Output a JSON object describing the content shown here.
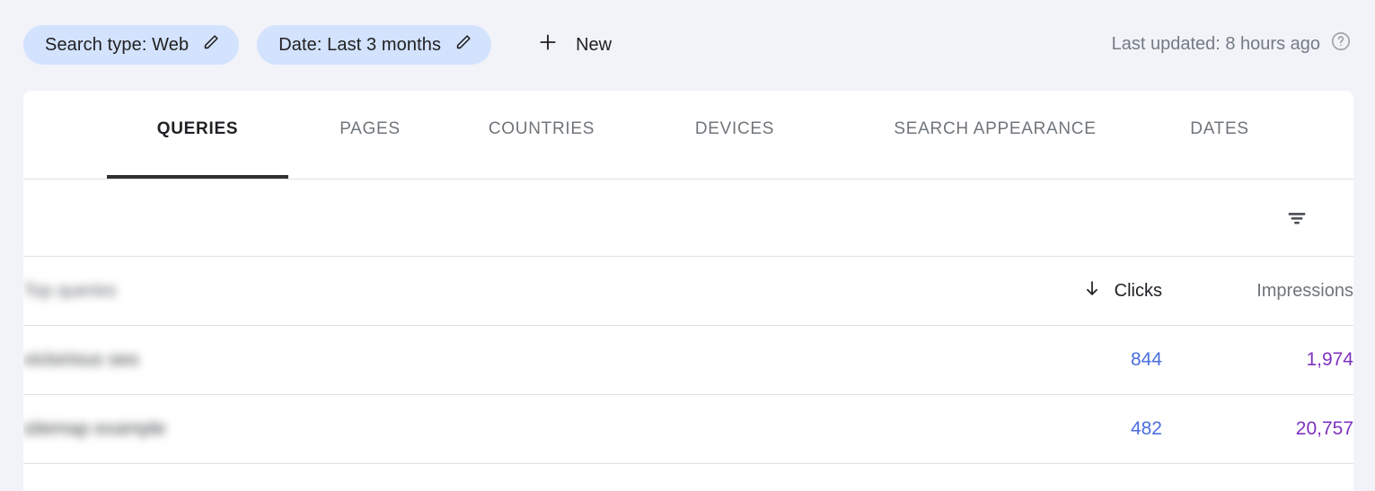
{
  "filter_bar": {
    "chips": [
      {
        "label": "Search type: Web",
        "edit_icon": "pencil-icon"
      },
      {
        "label": "Date: Last 3 months",
        "edit_icon": "pencil-icon"
      }
    ],
    "new_button": {
      "label": "New",
      "icon": "plus-icon"
    },
    "last_updated": {
      "text": "Last updated: 8 hours ago",
      "icon": "help-circle-icon"
    }
  },
  "tabs": [
    {
      "label": "QUERIES",
      "active": true
    },
    {
      "label": "PAGES",
      "active": false
    },
    {
      "label": "COUNTRIES",
      "active": false
    },
    {
      "label": "DEVICES",
      "active": false
    },
    {
      "label": "SEARCH APPEARANCE",
      "active": false
    },
    {
      "label": "DATES",
      "active": false
    }
  ],
  "toolbar": {
    "filter_icon": "filter-list-icon"
  },
  "table": {
    "headers": {
      "query": "Top queries",
      "clicks": "Clicks",
      "impressions": "Impressions"
    },
    "sort": {
      "column": "Clicks",
      "direction": "descending",
      "icon": "arrow-down-icon"
    },
    "rows": [
      {
        "query": "victorious seo",
        "clicks": "844",
        "impressions": "1,974"
      },
      {
        "query": "sitemap example",
        "clicks": "482",
        "impressions": "20,757"
      }
    ]
  },
  "colors": {
    "page_background": "#f1f3f9",
    "card_background": "#ffffff",
    "chip_background": "#d3e2fd",
    "active_tab_underline": "#303134",
    "clicks_value": "#4a6ee0",
    "impressions_value": "#7f31c0",
    "muted_text": "#70757a",
    "divider": "#e0e0e0"
  }
}
